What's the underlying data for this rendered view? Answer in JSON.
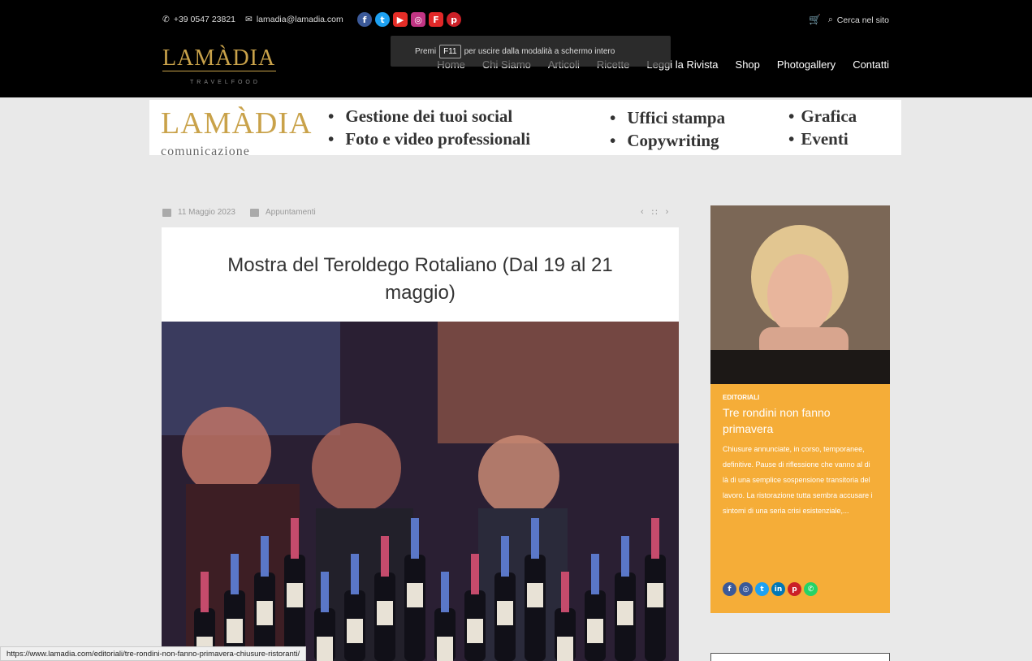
{
  "topbar": {
    "phone": "+39 0547 23821",
    "email": "lamadia@lamadia.com",
    "socials": [
      {
        "icon": "facebook-icon",
        "glyph": "f",
        "color": "#3b5998"
      },
      {
        "icon": "twitter-icon",
        "glyph": "t",
        "color": "#1da1f2"
      },
      {
        "icon": "youtube-icon",
        "glyph": "▶",
        "color": "#e52d27"
      },
      {
        "icon": "instagram-icon",
        "glyph": "◎",
        "color": "#c13584"
      },
      {
        "icon": "flipboard-icon",
        "glyph": "F",
        "color": "#e12828"
      },
      {
        "icon": "pinterest-icon",
        "glyph": "p",
        "color": "#cb2027"
      }
    ],
    "search_label": "Cerca nel sito"
  },
  "logo": {
    "text": "LAMÀDIA",
    "sub": "TRAVELFOOD"
  },
  "nav": [
    "Home",
    "Chi Siamo",
    "Articoli",
    "Ricette",
    "Leggi la Rivista",
    "Shop",
    "Photogallery",
    "Contatti"
  ],
  "fullscreen_toast": {
    "before": "Premi",
    "key": "F11",
    "after": "per uscire dalla modalità a schermo intero"
  },
  "banner": {
    "logo": "LAMÀDIA",
    "logo_sub": "comunicazione",
    "col1": [
      "Gestione dei tuoi social",
      "Foto e video professionali"
    ],
    "col2": [
      "Uffici stampa",
      "Copywriting"
    ],
    "col3": [
      "Grafica",
      "Eventi"
    ]
  },
  "article": {
    "date": "11 Maggio 2023",
    "category": "Appuntamenti",
    "title": "Mostra del Teroldego Rotaliano (Dal 19 al 21 maggio)",
    "nav_prev": "‹",
    "nav_grid": "∷",
    "nav_next": "›"
  },
  "sidebar": {
    "category": "EDITORIALI",
    "title": "Tre rondini non fanno primavera",
    "excerpt": "Chiusure annunciate, in corso, temporanee, definitive. Pause di riflessione che vanno al di là di una semplice sospensione transitoria del lavoro. La ristorazione tutta sembra accusare i sintomi di una seria crisi esistenziale,...",
    "share": [
      {
        "icon": "facebook-icon",
        "glyph": "f",
        "color": "#3b5998"
      },
      {
        "icon": "instagram-icon",
        "glyph": "◎",
        "color": "#3b5998"
      },
      {
        "icon": "twitter-icon",
        "glyph": "t",
        "color": "#1da1f2"
      },
      {
        "icon": "linkedin-icon",
        "glyph": "in",
        "color": "#0077b5"
      },
      {
        "icon": "pinterest-icon",
        "glyph": "p",
        "color": "#cb2027"
      },
      {
        "icon": "whatsapp-icon",
        "glyph": "✆",
        "color": "#25d366"
      }
    ]
  },
  "status_url": "https://www.lamadia.com/editoriali/tre-rondini-non-fanno-primavera-chiusure-ristoranti/"
}
